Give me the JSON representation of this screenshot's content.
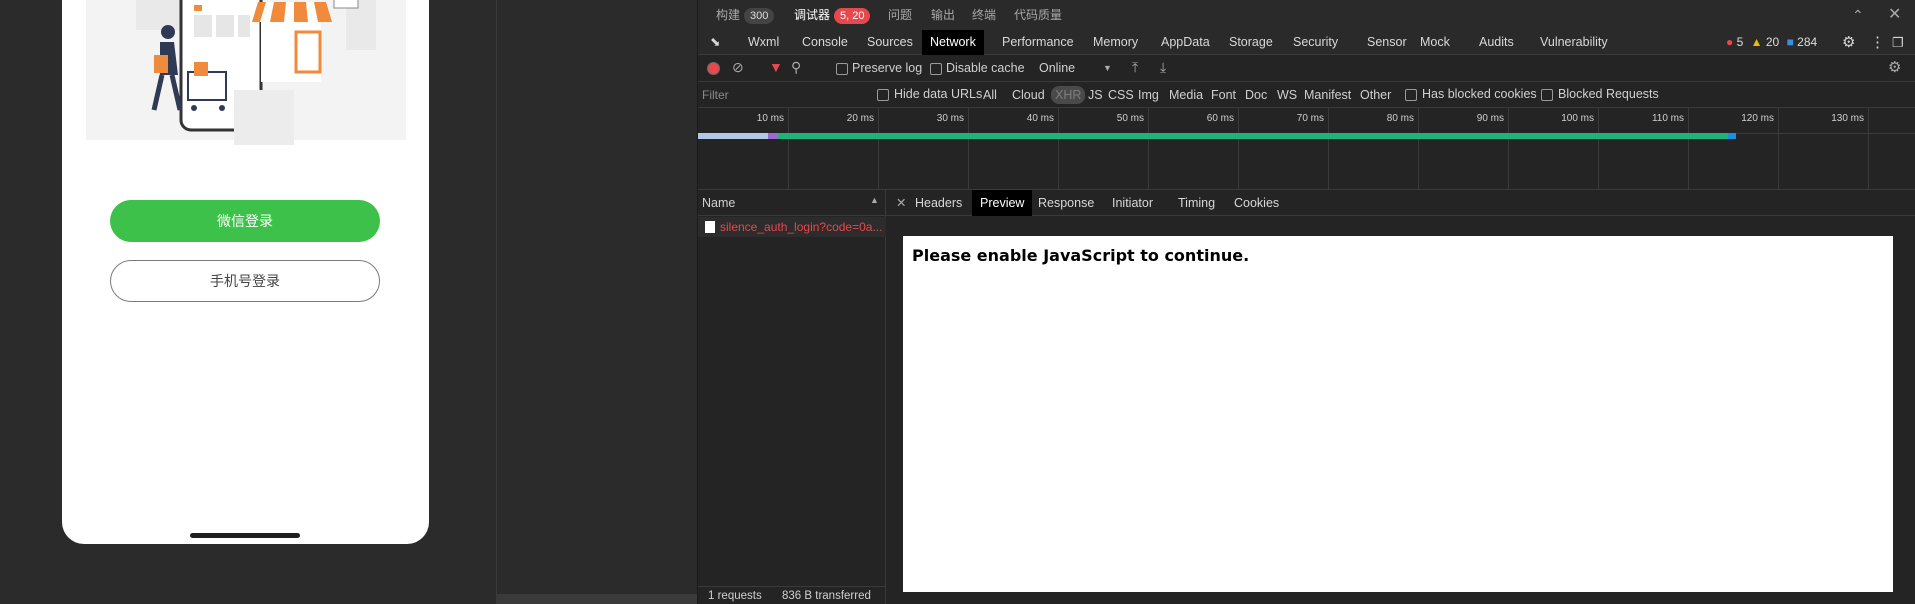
{
  "simulator": {
    "wechat_login_label": "微信登录",
    "phone_login_label": "手机号登录"
  },
  "devtools": {
    "top_tabs": [
      {
        "label": "构建",
        "badge": "300"
      },
      {
        "label": "调试器",
        "badge": "5, 20"
      },
      {
        "label": "问题"
      },
      {
        "label": "输出"
      },
      {
        "label": "终端"
      },
      {
        "label": "代码质量"
      }
    ],
    "main_tabs": [
      "Wxml",
      "Console",
      "Sources",
      "Network",
      "Performance",
      "Memory",
      "AppData",
      "Storage",
      "Security",
      "Sensor",
      "Mock",
      "Audits",
      "Vulnerability"
    ],
    "active_main_tab": "Network",
    "counts": {
      "errors": "5",
      "warnings": "20",
      "messages": "284"
    },
    "toolbar": {
      "preserve_log": "Preserve log",
      "disable_cache": "Disable cache",
      "throttle": "Online"
    },
    "filter": {
      "placeholder": "Filter",
      "hide_data_urls": "Hide data URLs",
      "types": [
        "All",
        "Cloud",
        "XHR",
        "JS",
        "CSS",
        "Img",
        "Media",
        "Font",
        "Doc",
        "WS",
        "Manifest",
        "Other"
      ],
      "active_type": "XHR",
      "has_blocked_cookies": "Has blocked cookies",
      "blocked_requests": "Blocked Requests"
    },
    "timeline": {
      "ticks": [
        "10 ms",
        "20 ms",
        "30 ms",
        "40 ms",
        "50 ms",
        "60 ms",
        "70 ms",
        "80 ms",
        "90 ms",
        "100 ms",
        "110 ms",
        "120 ms",
        "130 ms"
      ]
    },
    "requests": {
      "name_header": "Name",
      "items": [
        "silence_auth_login?code=0a..."
      ]
    },
    "detail_tabs": [
      "Headers",
      "Preview",
      "Response",
      "Initiator",
      "Timing",
      "Cookies"
    ],
    "active_detail_tab": "Preview",
    "preview_text": "Please enable JavaScript to continue.",
    "status": {
      "requests": "1 requests",
      "transferred": "836 B transferred"
    },
    "colors": {
      "accent_green": "#3ec14a",
      "error_red": "#e5484d",
      "bar_green": "#1fb37a",
      "bar_blue": "#1a8fe3"
    }
  }
}
